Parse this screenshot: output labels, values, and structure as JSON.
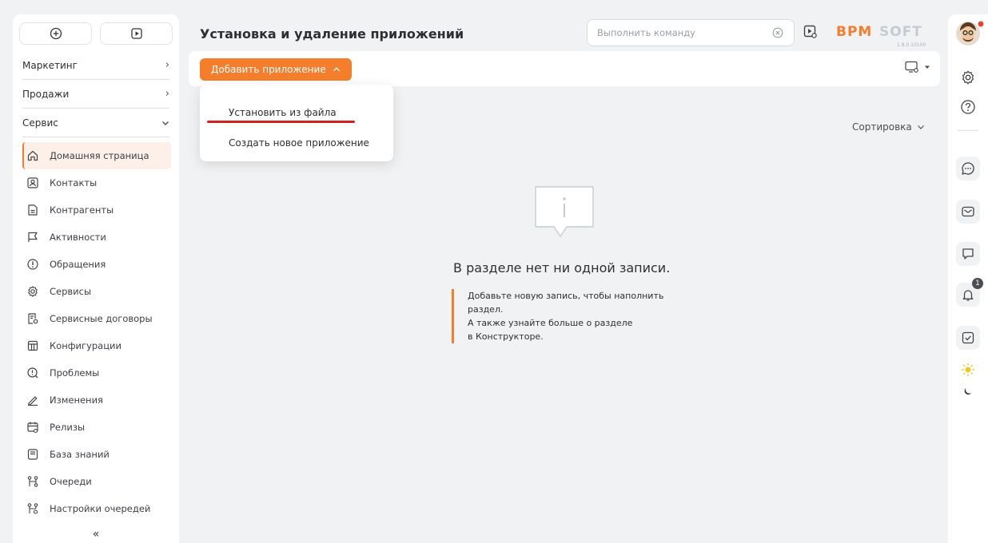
{
  "page": {
    "title": "Установка и удаление приложений"
  },
  "command": {
    "placeholder": "Выполнить команду"
  },
  "logo": {
    "text": "BPMSOFT",
    "version": "1.8.0.10100",
    "colors": {
      "primary": "#f47e2b",
      "secondary": "#c7cbd1"
    }
  },
  "toolbar": {
    "add_label": "Добавить приложение"
  },
  "menu": {
    "items": [
      {
        "label": "Установить из файла"
      },
      {
        "label": "Создать новое приложение"
      }
    ]
  },
  "sort": {
    "label": "Сортировка"
  },
  "empty": {
    "title": "В разделе нет ни одной записи.",
    "line1": "Добавьте новую запись, чтобы наполнить",
    "line2": "раздел.",
    "line3": "А также узнайте больше о разделе",
    "line4": "в Конструкторе."
  },
  "sidebar": {
    "groups": [
      {
        "label": "Маркетинг"
      },
      {
        "label": "Продажи"
      },
      {
        "label": "Сервис"
      }
    ],
    "items": [
      {
        "label": "Домашняя страница",
        "icon": "home-icon"
      },
      {
        "label": "Контакты",
        "icon": "contact-icon"
      },
      {
        "label": "Контрагенты",
        "icon": "document-icon"
      },
      {
        "label": "Активности",
        "icon": "flag-icon"
      },
      {
        "label": "Обращения",
        "icon": "alert-icon"
      },
      {
        "label": "Сервисы",
        "icon": "gear-icon"
      },
      {
        "label": "Сервисные договоры",
        "icon": "contract-icon"
      },
      {
        "label": "Конфигурации",
        "icon": "config-icon"
      },
      {
        "label": "Проблемы",
        "icon": "problem-icon"
      },
      {
        "label": "Изменения",
        "icon": "pencil-icon"
      },
      {
        "label": "Релизы",
        "icon": "calendar-icon"
      },
      {
        "label": "База знаний",
        "icon": "book-icon"
      },
      {
        "label": "Очереди",
        "icon": "queue-icon"
      },
      {
        "label": "Настройки очередей",
        "icon": "queue-settings-icon"
      }
    ],
    "collapse": "«"
  },
  "notifications": {
    "count": "1"
  },
  "colors": {
    "accent": "#f47e2b",
    "underline": "#d62020"
  }
}
